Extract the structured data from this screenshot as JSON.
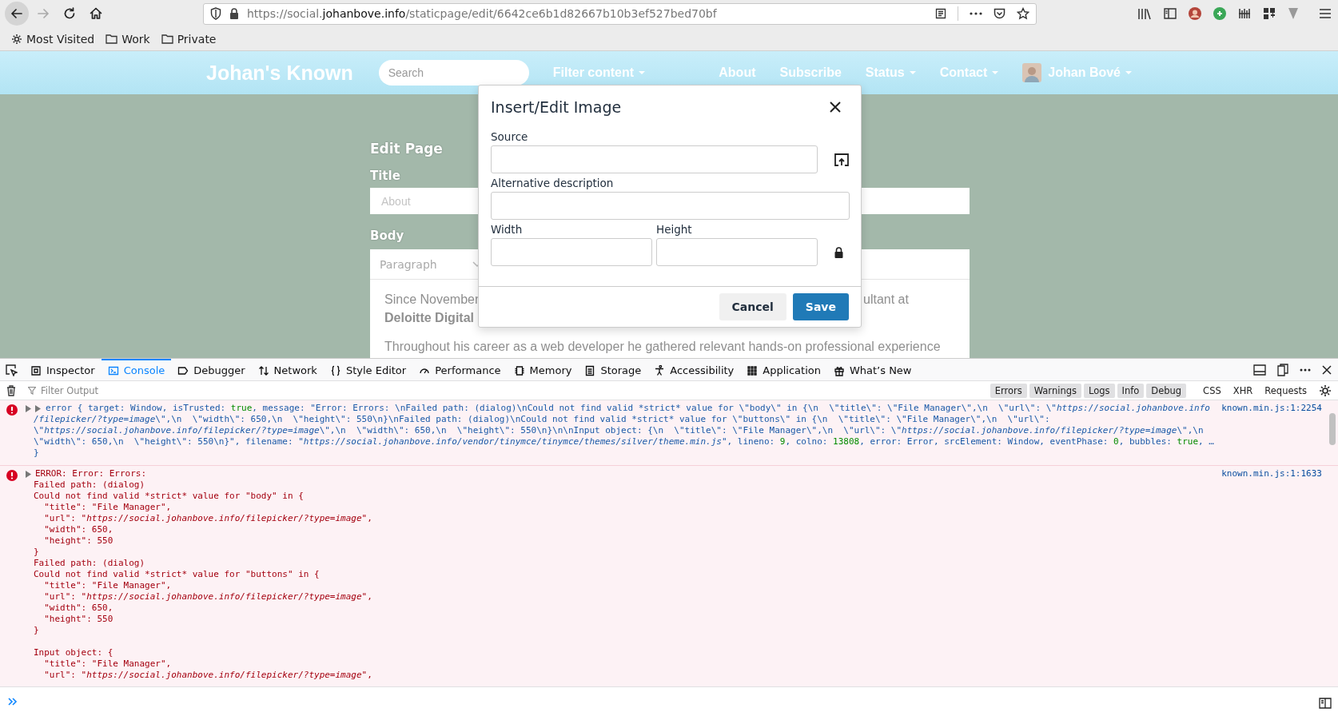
{
  "browser": {
    "nav_buttons": [
      {
        "kind": "back",
        "disabled": false
      },
      {
        "kind": "forward",
        "disabled": true
      },
      {
        "kind": "reload",
        "disabled": false
      },
      {
        "kind": "home",
        "disabled": false
      }
    ],
    "url": {
      "prefix": "https://social.",
      "domain": "johanbove.info",
      "path": "/staticpage/edit/6642ce6b1d82667b10b3ef527bed70bf"
    },
    "bookmarks": [
      {
        "kind": "gear",
        "label": "Most Visited"
      },
      {
        "kind": "folder",
        "label": "Work"
      },
      {
        "kind": "folder",
        "label": "Private"
      }
    ]
  },
  "site": {
    "brand": "Johan's Known",
    "search_placeholder": "Search",
    "filter": {
      "label": "Filter content",
      "dropdown": true
    },
    "nav": [
      {
        "label": "About",
        "dropdown": false
      },
      {
        "label": "Subscribe",
        "dropdown": false
      },
      {
        "label": "Status",
        "dropdown": true
      },
      {
        "label": "Contact",
        "dropdown": true
      }
    ],
    "user": {
      "name": "Johan Bové",
      "dropdown": true
    }
  },
  "edit_page": {
    "heading": "Edit Page",
    "title_label": "Title",
    "title_placeholder": "About",
    "body_label": "Body",
    "block_format": "Paragraph",
    "paragraph_1_start": "Since November",
    "paragraph_1_end": "ultant at",
    "paragraph_1_line_2": "Deloitte Digital",
    "paragraph_2": "Throughout his career as a web developer he gathered relevant hands-on professional experience"
  },
  "dialog": {
    "title": "Insert/Edit Image",
    "source_label": "Source",
    "alt_label": "Alternative description",
    "width_label": "Width",
    "height_label": "Height",
    "buttons": [
      {
        "label": "Cancel",
        "kind": "secondary"
      },
      {
        "label": "Save",
        "kind": "primary"
      }
    ]
  },
  "devtools": {
    "tabs": [
      {
        "label": "Inspector",
        "selected": false
      },
      {
        "label": "Console",
        "selected": true
      },
      {
        "label": "Debugger",
        "selected": false
      },
      {
        "label": "Network",
        "selected": false
      },
      {
        "label": "Style Editor",
        "selected": false
      },
      {
        "label": "Performance",
        "selected": false
      },
      {
        "label": "Memory",
        "selected": false
      },
      {
        "label": "Storage",
        "selected": false
      },
      {
        "label": "Accessibility",
        "selected": false
      },
      {
        "label": "Application",
        "selected": false
      },
      {
        "label": "What’s New",
        "selected": false
      }
    ],
    "filter_placeholder": "Filter Output",
    "filters": [
      {
        "label": "Errors",
        "selected": true
      },
      {
        "label": "Warnings",
        "selected": true
      },
      {
        "label": "Logs",
        "selected": true
      },
      {
        "label": "Info",
        "selected": true
      },
      {
        "label": "Debug",
        "selected": true
      },
      {
        "label": "CSS",
        "selected": false
      },
      {
        "label": "XHR",
        "selected": false
      },
      {
        "label": "Requests",
        "selected": false
      }
    ],
    "messages": [
      {
        "kind": "object",
        "source": "known.min.js:1:2254",
        "lines": [
          {
            "segments": [
              {
                "kind": "text",
                "text": "error { target: Window, isTrusted: "
              },
              {
                "kind": "num",
                "text": "true"
              },
              {
                "kind": "text",
                "text": ", message: \"Error: Errors: \\nFailed path: (dialog)\\nCould not find valid *strict* value for \\\"body\\\" in {\\n  \\\"title\\\": \\\"File Manager\\\",\\n  \\\"url\\\": \\\""
              },
              {
                "kind": "url",
                "text": "https://social.johanbove.info"
              }
            ]
          },
          {
            "segments": [
              {
                "kind": "url",
                "text": "/filepicker/?type=image"
              },
              {
                "kind": "text",
                "text": "\\\",\\n  \\\"width\\\": 650,\\n  \\\"height\\\": 550\\n}\\nFailed path: (dialog)\\nCould not find valid *strict* value for \\\"buttons\\\" in {\\n  \\\"title\\\": \\\"File Manager\\\",\\n  \\\"url\\\":"
              }
            ]
          },
          {
            "segments": [
              {
                "kind": "text",
                "text": "\\\""
              },
              {
                "kind": "url",
                "text": "https://social.johanbove.info/filepicker/?type=image"
              },
              {
                "kind": "text",
                "text": "\\\",\\n  \\\"width\\\": 650,\\n  \\\"height\\\": 550\\n}\\n\\nInput object: {\\n  \\\"title\\\": \\\"File Manager\\\",\\n  \\\"url\\\": \\\""
              },
              {
                "kind": "url",
                "text": "https://social.johanbove.info/filepicker/?type=image"
              },
              {
                "kind": "text",
                "text": "\\\",\\n"
              }
            ]
          },
          {
            "segments": [
              {
                "kind": "text",
                "text": "\\\"width\\\": 650,\\n  \\\"height\\\": 550\\n}\", filename: \""
              },
              {
                "kind": "url",
                "text": "https://social.johanbove.info/vendor/tinymce/tinymce/themes/silver/theme.min.js"
              },
              {
                "kind": "text",
                "text": "\", lineno: "
              },
              {
                "kind": "num",
                "text": "9"
              },
              {
                "kind": "text",
                "text": ", colno: "
              },
              {
                "kind": "num",
                "text": "13808"
              },
              {
                "kind": "text",
                "text": ", error: Error, srcElement: Window, eventPhase: "
              },
              {
                "kind": "num",
                "text": "0"
              },
              {
                "kind": "text",
                "text": ", bubbles: "
              },
              {
                "kind": "num",
                "text": "true"
              },
              {
                "kind": "text",
                "text": ", …"
              }
            ]
          },
          {
            "segments": [
              {
                "kind": "text",
                "text": "}"
              }
            ]
          }
        ]
      },
      {
        "kind": "text",
        "source": "known.min.js:1:1633",
        "lines": [
          {
            "segments": [
              {
                "kind": "text",
                "text": "ERROR: Error: Errors:"
              }
            ]
          },
          {
            "segments": [
              {
                "kind": "text",
                "text": "Failed path: (dialog)"
              }
            ]
          },
          {
            "segments": [
              {
                "kind": "text",
                "text": "Could not find valid *strict* value for \"body\" in {"
              }
            ]
          },
          {
            "segments": [
              {
                "kind": "text",
                "text": "  \"title\": \"File Manager\","
              }
            ]
          },
          {
            "segments": [
              {
                "kind": "text",
                "text": "  \"url\": \""
              },
              {
                "kind": "url",
                "text": "https://social.johanbove.info/filepicker/?type=image"
              },
              {
                "kind": "text",
                "text": "\","
              }
            ]
          },
          {
            "segments": [
              {
                "kind": "text",
                "text": "  \"width\": 650,"
              }
            ]
          },
          {
            "segments": [
              {
                "kind": "text",
                "text": "  \"height\": 550"
              }
            ]
          },
          {
            "segments": [
              {
                "kind": "text",
                "text": "}"
              }
            ]
          },
          {
            "segments": [
              {
                "kind": "text",
                "text": "Failed path: (dialog)"
              }
            ]
          },
          {
            "segments": [
              {
                "kind": "text",
                "text": "Could not find valid *strict* value for \"buttons\" in {"
              }
            ]
          },
          {
            "segments": [
              {
                "kind": "text",
                "text": "  \"title\": \"File Manager\","
              }
            ]
          },
          {
            "segments": [
              {
                "kind": "text",
                "text": "  \"url\": \""
              },
              {
                "kind": "url",
                "text": "https://social.johanbove.info/filepicker/?type=image"
              },
              {
                "kind": "text",
                "text": "\","
              }
            ]
          },
          {
            "segments": [
              {
                "kind": "text",
                "text": "  \"width\": 650,"
              }
            ]
          },
          {
            "segments": [
              {
                "kind": "text",
                "text": "  \"height\": 550"
              }
            ]
          },
          {
            "segments": [
              {
                "kind": "text",
                "text": "}"
              }
            ]
          },
          {
            "blank_before": true,
            "segments": [
              {
                "kind": "text",
                "text": "Input object: {"
              }
            ]
          },
          {
            "segments": [
              {
                "kind": "text",
                "text": "  \"title\": \"File Manager\","
              }
            ]
          },
          {
            "segments": [
              {
                "kind": "text",
                "text": "  \"url\": \""
              },
              {
                "kind": "url",
                "text": "https://social.johanbove.info/filepicker/?type=image"
              },
              {
                "kind": "text",
                "text": "\","
              }
            ]
          }
        ]
      }
    ]
  }
}
